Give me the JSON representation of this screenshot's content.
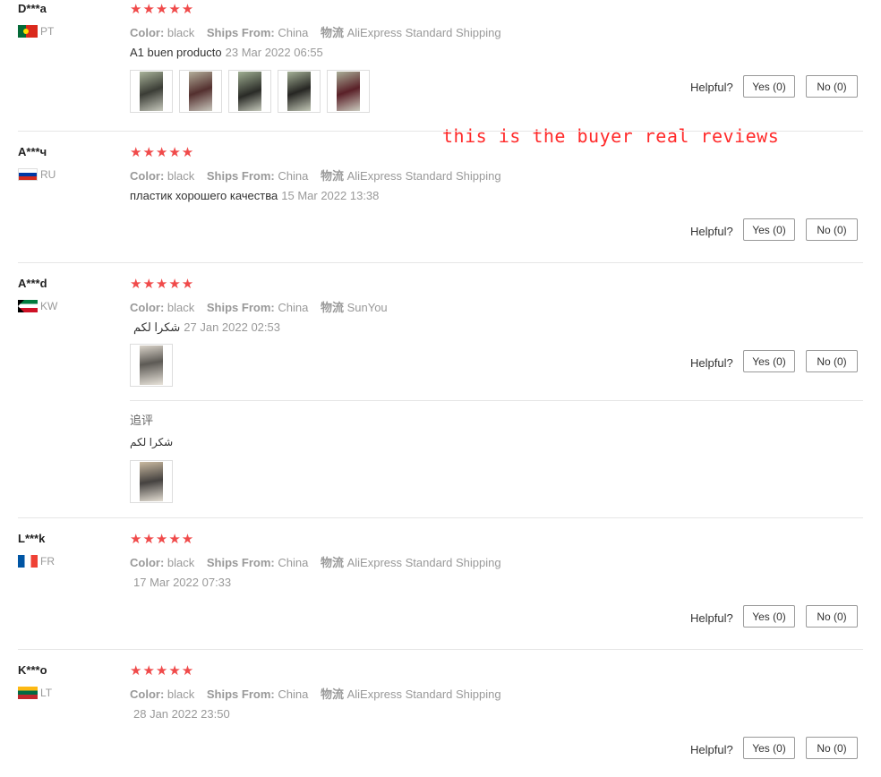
{
  "labels": {
    "color": "Color:",
    "ships_from": "Ships From:",
    "logistics": "物流",
    "helpful": "Helpful?",
    "yes": "Yes (0)",
    "no": "No (0)",
    "stars": "★★★★★",
    "followup": "追评"
  },
  "annotation": "this is the buyer real reviews",
  "colors": {
    "star": "#f04a4a",
    "annotation": "#ff2a2a"
  },
  "reviews": [
    {
      "user": "D***a",
      "country": "PT",
      "rating": 5,
      "color": "black",
      "ships_from": "China",
      "shipping": "AliExpress Standard Shipping",
      "text": "A1 buen producto",
      "date": "23 Mar 2022 06:55",
      "image_count": 5
    },
    {
      "user": "A***ч",
      "country": "RU",
      "rating": 5,
      "color": "black",
      "ships_from": "China",
      "shipping": "AliExpress Standard Shipping",
      "text": "пластик хорошего качества",
      "date": "15 Mar 2022 13:38",
      "image_count": 0
    },
    {
      "user": "A***d",
      "country": "KW",
      "rating": 5,
      "color": "black",
      "ships_from": "China",
      "shipping": "SunYou",
      "text": "شكرا لكم",
      "date": "27 Jan 2022 02:53",
      "image_count": 1,
      "followup_text": "شكرا لكم",
      "followup_image_count": 1
    },
    {
      "user": "L***k",
      "country": "FR",
      "rating": 5,
      "color": "black",
      "ships_from": "China",
      "shipping": "AliExpress Standard Shipping",
      "text": "",
      "date": "17 Mar 2022 07:33",
      "image_count": 0
    },
    {
      "user": "K***o",
      "country": "LT",
      "rating": 5,
      "color": "black",
      "ships_from": "China",
      "shipping": "AliExpress Standard Shipping",
      "text": "",
      "date": "28 Jan 2022 23:50",
      "image_count": 0
    }
  ]
}
